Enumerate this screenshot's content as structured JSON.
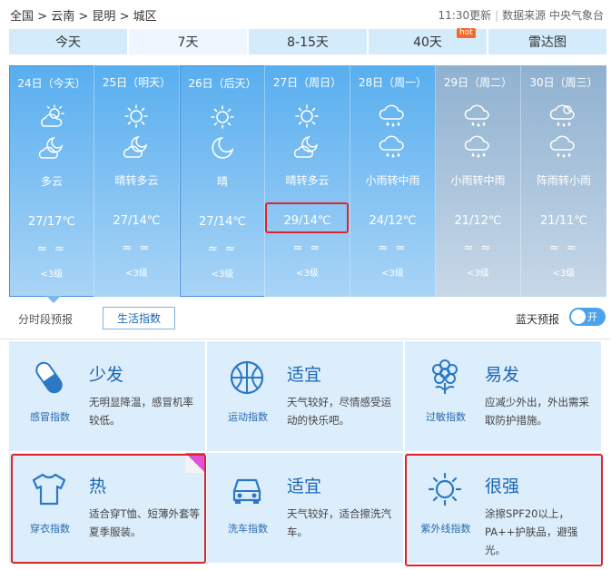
{
  "breadcrumb": [
    "全国",
    "云南",
    "昆明",
    "城区"
  ],
  "breadcrumb_sep": ">",
  "update": {
    "time": "11:30更新",
    "source": "数据来源 中央气象台"
  },
  "tabs": [
    {
      "label": "今天"
    },
    {
      "label": "7天"
    },
    {
      "label": "8-15天"
    },
    {
      "label": "40天",
      "badge": "hot"
    },
    {
      "label": "雷达图"
    }
  ],
  "days": [
    {
      "date": "24日（今天）",
      "day_icon": "partly-cloudy-icon",
      "night_icon": "moon-cloud-icon",
      "desc": "多云",
      "temp": "27/17℃",
      "wind": "≈ ≈",
      "level": "<3级"
    },
    {
      "date": "25日（明天）",
      "day_icon": "sun-icon",
      "night_icon": "moon-cloud-icon",
      "desc": "晴转多云",
      "temp": "27/14℃",
      "wind": "≈ ≈",
      "level": "<3级"
    },
    {
      "date": "26日（后天）",
      "day_icon": "sun-icon",
      "night_icon": "moon-icon",
      "desc": "晴",
      "temp": "27/14℃",
      "wind": "≈ ≈",
      "level": "<3级"
    },
    {
      "date": "27日（周日）",
      "day_icon": "sun-icon",
      "night_icon": "moon-cloud-icon",
      "desc": "晴转多云",
      "temp": "29/14℃",
      "wind": "≈ ≈",
      "level": "<3级"
    },
    {
      "date": "28日（周一）",
      "day_icon": "rain-icon",
      "night_icon": "rain-icon",
      "desc": "小雨转中雨",
      "temp": "24/12℃",
      "wind": "≈ ≈",
      "level": "<3级"
    },
    {
      "date": "29日（周二）",
      "day_icon": "rain-icon",
      "night_icon": "rain-icon",
      "desc": "小雨转中雨",
      "temp": "21/12℃",
      "wind": "≈ ≈",
      "level": "<3级"
    },
    {
      "date": "30日（周三）",
      "day_icon": "shower-icon",
      "night_icon": "rain-icon",
      "desc": "阵雨转小雨",
      "temp": "21/11℃",
      "wind": "≈ ≈",
      "level": "<3级"
    }
  ],
  "subtabs": {
    "hourly": "分时段预报",
    "life": "生活指数"
  },
  "bluesky": {
    "label": "蓝天预报",
    "toggle": "开"
  },
  "indices": [
    {
      "name": "感冒指数",
      "level": "少发",
      "desc": "无明显降温，感冒机率较低。",
      "icon": "pill-icon"
    },
    {
      "name": "运动指数",
      "level": "适宜",
      "desc": "天气较好，尽情感受运动的快乐吧。",
      "icon": "basketball-icon"
    },
    {
      "name": "过敏指数",
      "level": "易发",
      "desc": "应减少外出，外出需采取防护措施。",
      "icon": "flower-icon"
    },
    {
      "name": "穿衣指数",
      "level": "热",
      "desc": "适合穿T恤、短薄外套等夏季服装。",
      "icon": "tshirt-icon"
    },
    {
      "name": "洗车指数",
      "level": "适宜",
      "desc": "天气较好，适合擦洗汽车。",
      "icon": "car-icon"
    },
    {
      "name": "紫外线指数",
      "level": "很强",
      "desc": "涂擦SPF20以上，PA++护肤品，避强光。",
      "icon": "sun-icon"
    }
  ],
  "colors": {
    "day_gradient_top": "#58aeef",
    "day_gradient_bottom": "#a9d4f6",
    "gray_gradient_top": "#8fb1d0",
    "gray_gradient_bottom": "#c7d8e8",
    "card_bg": "#dcedfb",
    "accent_blue": "#1b67b6",
    "highlight_red": "#e0242c"
  }
}
